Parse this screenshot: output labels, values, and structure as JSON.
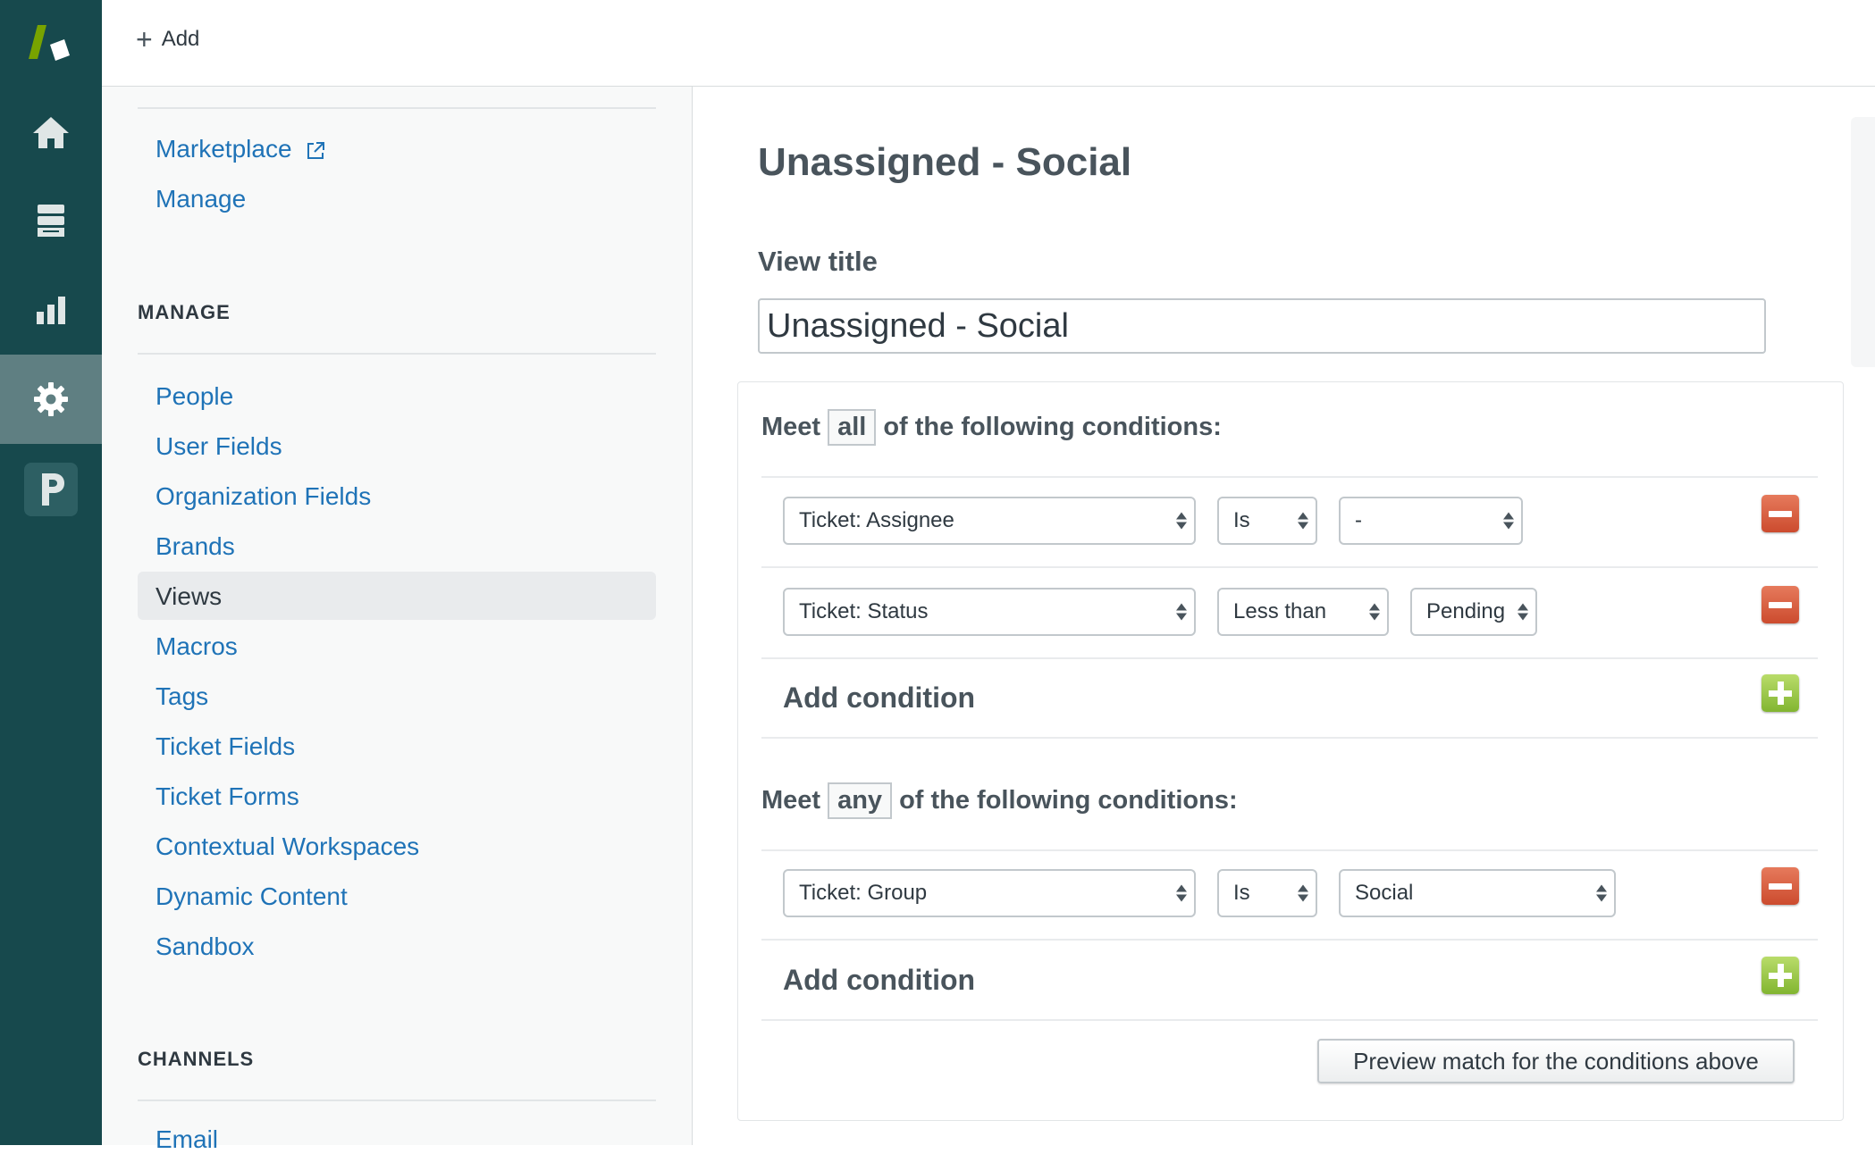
{
  "topbar": {
    "add_label": "Add"
  },
  "sidebar": {
    "top_links": [
      {
        "label": "Marketplace"
      },
      {
        "label": "Manage"
      }
    ],
    "manage_heading": "MANAGE",
    "manage_items": [
      {
        "label": "People"
      },
      {
        "label": "User Fields"
      },
      {
        "label": "Organization Fields"
      },
      {
        "label": "Brands"
      },
      {
        "label": "Views"
      },
      {
        "label": "Macros"
      },
      {
        "label": "Tags"
      },
      {
        "label": "Ticket Fields"
      },
      {
        "label": "Ticket Forms"
      },
      {
        "label": "Contextual Workspaces"
      },
      {
        "label": "Dynamic Content"
      },
      {
        "label": "Sandbox"
      }
    ],
    "channels_heading": "CHANNELS",
    "channels_items": [
      {
        "label": "Email"
      }
    ]
  },
  "main": {
    "page_title": "Unassigned - Social",
    "view_title_label": "View title",
    "view_title_value": "Unassigned - Social",
    "all_group": {
      "meet_prefix": "Meet",
      "meet_mode": "all",
      "meet_suffix": "of the following conditions:",
      "rows": [
        {
          "field": "Ticket: Assignee",
          "operator": "Is",
          "value": "-"
        },
        {
          "field": "Ticket: Status",
          "operator": "Less than",
          "value": "Pending"
        }
      ],
      "add_condition_label": "Add condition"
    },
    "any_group": {
      "meet_prefix": "Meet",
      "meet_mode": "any",
      "meet_suffix": "of the following conditions:",
      "rows": [
        {
          "field": "Ticket: Group",
          "operator": "Is",
          "value": "Social"
        }
      ],
      "add_condition_label": "Add condition"
    },
    "preview_button_label": "Preview match for the conditions above"
  },
  "colors": {
    "rail": "#17494d",
    "rail_active": "#5f7f82",
    "link": "#1f73b7",
    "remove": "#cc4b2e",
    "add": "#82b531"
  },
  "icons": {
    "logo": "zendesk-logo-icon",
    "rail": [
      "home-icon",
      "views-icon",
      "reporting-icon",
      "admin-gear-icon",
      "app-p-icon"
    ]
  }
}
